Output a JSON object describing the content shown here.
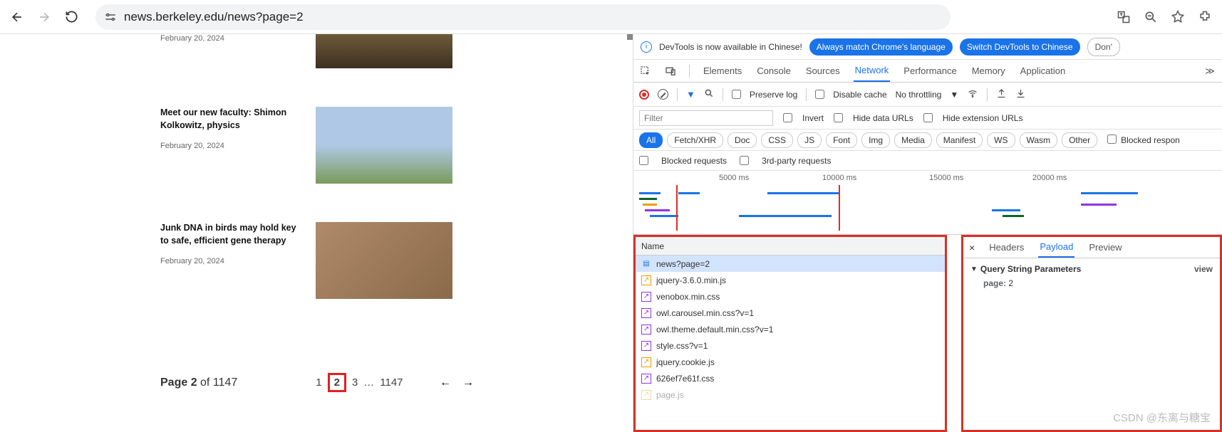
{
  "url": "news.berkeley.edu/news?page=2",
  "articles": [
    {
      "title": "",
      "date": "February 20, 2024"
    },
    {
      "title": "Meet our new faculty: Shimon Kolkowitz, physics",
      "date": "February 20, 2024"
    },
    {
      "title": "Junk DNA in birds may hold key to safe, efficient gene therapy",
      "date": "February 20, 2024"
    }
  ],
  "pager": {
    "label": "Page 2 ",
    "of": "of 1147",
    "nums": [
      "1",
      "2",
      "3",
      "…",
      "1147"
    ]
  },
  "banner": {
    "text": "DevTools is now available in Chinese!",
    "btn1": "Always match Chrome's language",
    "btn2": "Switch DevTools to Chinese",
    "btn3": "Don'"
  },
  "tabs": [
    "Elements",
    "Console",
    "Sources",
    "Network",
    "Performance",
    "Memory",
    "Application"
  ],
  "filter": {
    "preserve": "Preserve log",
    "disable": "Disable cache",
    "throttle": "No throttling"
  },
  "row2": {
    "placeholder": "Filter",
    "invert": "Invert",
    "hide_urls": "Hide data URLs",
    "hide_ext": "Hide extension URLs"
  },
  "types": [
    "All",
    "Fetch/XHR",
    "Doc",
    "CSS",
    "JS",
    "Font",
    "Img",
    "Media",
    "Manifest",
    "WS",
    "Wasm",
    "Other"
  ],
  "blocked_resp": "Blocked respon",
  "row4": {
    "blocked": "Blocked requests",
    "third": "3rd-party requests"
  },
  "tl_labels": [
    "5000 ms",
    "10000 ms",
    "15000 ms",
    "20000 ms"
  ],
  "req_hdr": "Name",
  "requests": [
    {
      "name": "news?page=2",
      "type": "doc",
      "sel": true
    },
    {
      "name": "jquery-3.6.0.min.js",
      "type": "js"
    },
    {
      "name": "venobox.min.css",
      "type": "css"
    },
    {
      "name": "owl.carousel.min.css?v=1",
      "type": "css"
    },
    {
      "name": "owl.theme.default.min.css?v=1",
      "type": "css"
    },
    {
      "name": "style.css?v=1",
      "type": "css"
    },
    {
      "name": "jquery.cookie.js",
      "type": "js"
    },
    {
      "name": "626ef7e61f.css",
      "type": "css"
    },
    {
      "name": "page.js",
      "type": "js",
      "cut": true
    }
  ],
  "det_tabs": [
    "Headers",
    "Payload",
    "Preview"
  ],
  "det_section": "Query String Parameters",
  "det_view": "view",
  "det_param_key": "page:",
  "det_param_val": "2",
  "watermark": "CSDN @东离与糖宝"
}
